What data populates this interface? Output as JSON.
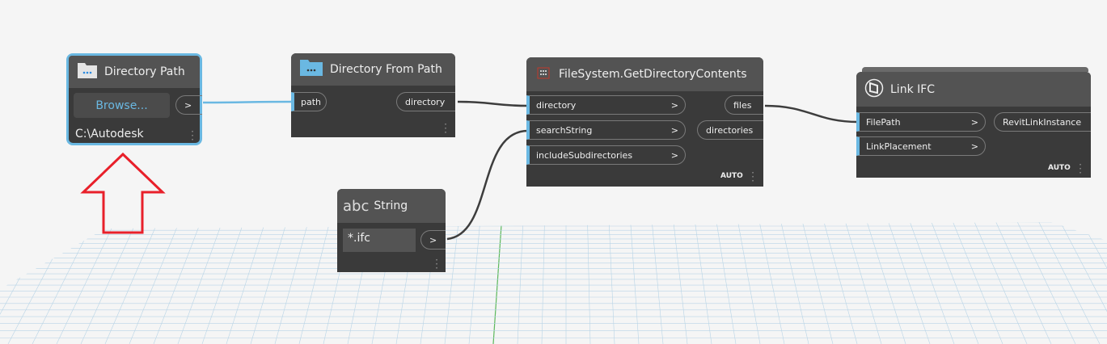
{
  "nodes": {
    "directory_path": {
      "title": "Directory Path",
      "button": "Browse...",
      "value": "C:\\Autodesk",
      "out": ">"
    },
    "directory_from_path": {
      "title": "Directory From Path",
      "input": "path",
      "output": "directory"
    },
    "get_directory_contents": {
      "title": "FileSystem.GetDirectoryContents",
      "inputs": [
        "directory",
        "searchString",
        "includeSubdirectories"
      ],
      "outputs": [
        "files",
        "directories"
      ],
      "lacing": "AUTO"
    },
    "link_ifc": {
      "title": "Link IFC",
      "inputs": [
        "FilePath",
        "LinkPlacement"
      ],
      "outputs": [
        "RevitLinkInstance"
      ],
      "lacing": "AUTO"
    },
    "string": {
      "icon_text": "abc",
      "title": "String",
      "value": "*.ifc",
      "out": ">"
    }
  },
  "chevron": ">",
  "colors": {
    "accent": "#6ab8e2",
    "arrow": "#e8202a",
    "node_body": "#3a3a3a",
    "node_header": "#535353"
  }
}
